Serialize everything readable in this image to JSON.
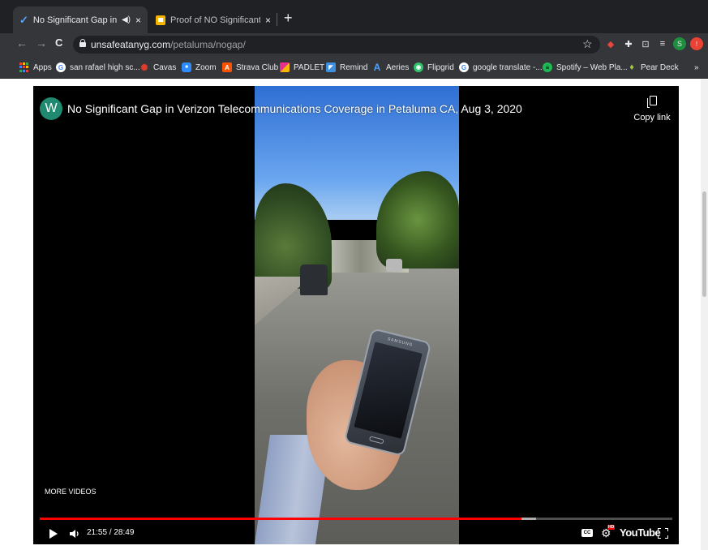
{
  "tabs": [
    {
      "title": "No Significant Gap in Veriz",
      "favicon": "checkmark-icon",
      "audio": true,
      "close": "×"
    },
    {
      "title": "Proof of NO Significant Gap of",
      "favicon": "slides-icon",
      "close": "×"
    }
  ],
  "new_tab": "+",
  "toolbar": {
    "back": "←",
    "forward": "→",
    "reload": "C",
    "url_domain": "unsafeatanyg.com",
    "url_path": "/petaluma/nogap/",
    "star": "☆",
    "profile": "S"
  },
  "bookmarks": [
    {
      "label": "Apps",
      "icon": "apps-grid-icon"
    },
    {
      "label": "san rafael high sc...",
      "icon": "google-icon",
      "color": "#ffffff",
      "glyph": "G"
    },
    {
      "label": "Cavas",
      "icon": "canvas-icon",
      "color": "#e13c2c",
      "glyph": "✺"
    },
    {
      "label": "Zoom",
      "icon": "zoom-icon",
      "color": "#2d8cff",
      "glyph": "■"
    },
    {
      "label": "Strava Club",
      "icon": "strava-icon",
      "color": "#fc5200",
      "glyph": "A"
    },
    {
      "label": "PADLET",
      "icon": "padlet-icon",
      "color": "#e8308a",
      "glyph": "▚"
    },
    {
      "label": "Remind",
      "icon": "remind-icon",
      "color": "#3d8fe0",
      "glyph": "◤"
    },
    {
      "label": "Aeries",
      "icon": "aeries-icon",
      "color": "#35363a",
      "glyph": "A"
    },
    {
      "label": "Flipgrid",
      "icon": "flipgrid-icon",
      "color": "#31c46c",
      "glyph": "◉"
    },
    {
      "label": "google translate -...",
      "icon": "google-icon",
      "color": "#ffffff",
      "glyph": "G"
    },
    {
      "label": "Spotify – Web Pla...",
      "icon": "spotify-icon",
      "color": "#1db954",
      "glyph": "≡"
    },
    {
      "label": "Pear Deck",
      "icon": "pear-deck-icon",
      "color": "#a2c845",
      "glyph": "♦"
    }
  ],
  "bookmarks_overflow": "»",
  "video": {
    "channel_initial": "W",
    "title": "No Significant Gap in Verizon Telecommunications Coverage in Petaluma CA, Aug 3, 2020",
    "copy_link": "Copy link",
    "more_videos": "MORE VIDEOS",
    "time": "21:55 / 28:49",
    "played_fraction": 0.762,
    "loaded_fraction": 0.785,
    "phone_brand": "SAMSUNG",
    "cc": "CC",
    "hd": "HD",
    "logo": "YouTube"
  },
  "colors": {
    "progress_played": "#ff0000",
    "chrome_dark": "#202124",
    "chrome_toolbar": "#35363a",
    "channel_avatar": "#1f8a6f"
  }
}
